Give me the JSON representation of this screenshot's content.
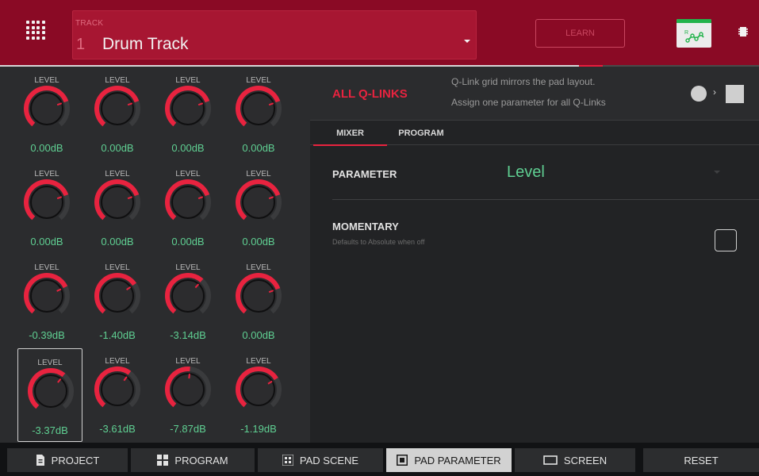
{
  "header": {
    "track_label": "TRACK",
    "track_number": "1",
    "track_name": "Drum Track",
    "learn_label": "LEARN",
    "menu_icon": "grid-menu-icon",
    "automation_icon": "automation-icon",
    "cpu_icon": "chip-icon",
    "accent_color": "#8a0a25"
  },
  "knobs": [
    {
      "label": "LEVEL",
      "value": "0.00dB",
      "fill": 0.75
    },
    {
      "label": "LEVEL",
      "value": "0.00dB",
      "fill": 0.75
    },
    {
      "label": "LEVEL",
      "value": "0.00dB",
      "fill": 0.75
    },
    {
      "label": "LEVEL",
      "value": "0.00dB",
      "fill": 0.75
    },
    {
      "label": "LEVEL",
      "value": "0.00dB",
      "fill": 0.75
    },
    {
      "label": "LEVEL",
      "value": "0.00dB",
      "fill": 0.75
    },
    {
      "label": "LEVEL",
      "value": "0.00dB",
      "fill": 0.75
    },
    {
      "label": "LEVEL",
      "value": "0.00dB",
      "fill": 0.75
    },
    {
      "label": "LEVEL",
      "value": "-0.39dB",
      "fill": 0.73
    },
    {
      "label": "LEVEL",
      "value": "-1.40dB",
      "fill": 0.7
    },
    {
      "label": "LEVEL",
      "value": "-3.14dB",
      "fill": 0.65
    },
    {
      "label": "LEVEL",
      "value": "0.00dB",
      "fill": 0.75
    },
    {
      "label": "LEVEL",
      "value": "-3.37dB",
      "fill": 0.64,
      "selected": true
    },
    {
      "label": "LEVEL",
      "value": "-3.61dB",
      "fill": 0.63
    },
    {
      "label": "LEVEL",
      "value": "-7.87dB",
      "fill": 0.52
    },
    {
      "label": "LEVEL",
      "value": "-1.19dB",
      "fill": 0.71
    }
  ],
  "qlinks": {
    "title": "ALL Q-LINKS",
    "desc_line1": "Q-Link grid mirrors the pad layout.",
    "desc_line2": "Assign one parameter for all Q-Links",
    "mode_arrow": "›",
    "mode_icons": [
      "circle-mode-icon",
      "square-mode-icon"
    ]
  },
  "tabs": [
    {
      "label": "MIXER",
      "active": true
    },
    {
      "label": "PROGRAM",
      "active": false
    }
  ],
  "parameter": {
    "label": "PARAMETER",
    "value": "Level"
  },
  "momentary": {
    "label": "MOMENTARY",
    "sub": "Defaults to Absolute when off",
    "checked": false
  },
  "bottom_bar": [
    {
      "label": "PROJECT",
      "icon": "project-file-icon",
      "active": false
    },
    {
      "label": "PROGRAM",
      "icon": "program-grid-icon",
      "active": false
    },
    {
      "label": "PAD SCENE",
      "icon": "pad-scene-icon",
      "active": false
    },
    {
      "label": "PAD PARAMETER",
      "icon": "pad-parameter-icon",
      "active": true
    },
    {
      "label": "SCREEN",
      "icon": "screen-icon",
      "active": false
    },
    {
      "label": "RESET",
      "icon": "",
      "active": false
    }
  ],
  "colors": {
    "red": "#e8233f",
    "green": "#5fcf92",
    "knob_track": "#3a3b3d",
    "knob_body": "#2c2c2e"
  }
}
